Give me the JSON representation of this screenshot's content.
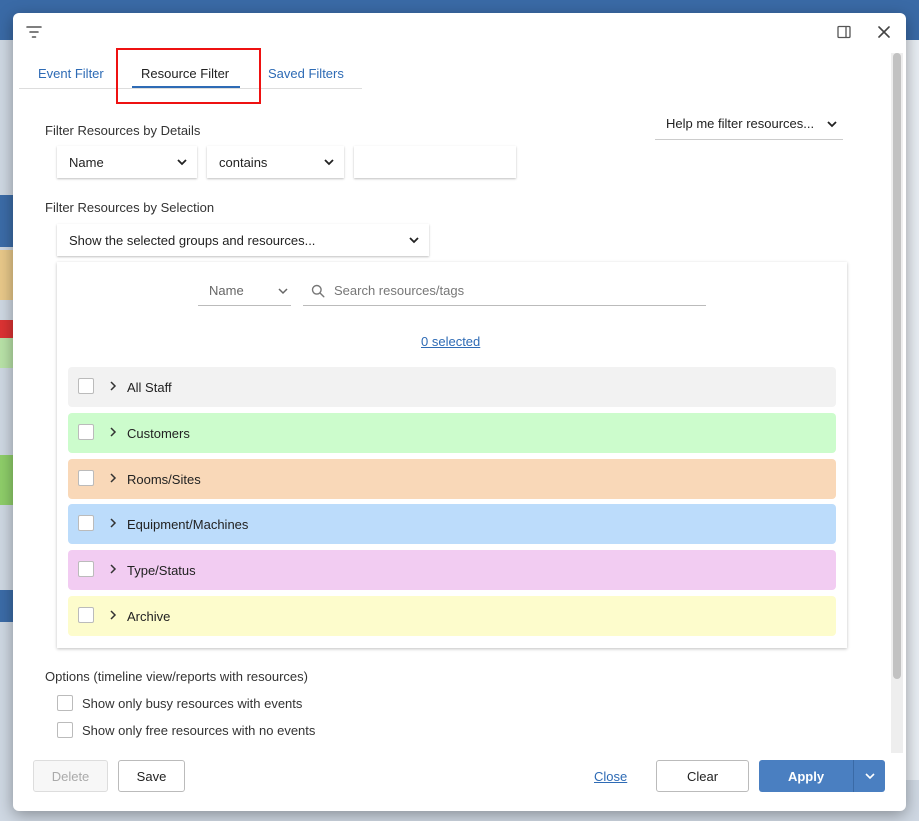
{
  "tabs": [
    {
      "label": "Event Filter"
    },
    {
      "label": "Resource Filter"
    },
    {
      "label": "Saved Filters"
    }
  ],
  "details": {
    "heading": "Filter Resources by Details",
    "field_select": "Name",
    "operator_select": "contains",
    "value": "",
    "help_dropdown": "Help me filter resources..."
  },
  "selection": {
    "heading": "Filter Resources by Selection",
    "mode_select": "Show the selected groups and resources...",
    "sort_select": "Name",
    "search_placeholder": "Search resources/tags",
    "selected_count": "0 selected",
    "groups": [
      {
        "name": "All Staff",
        "color": "#f2f2f2"
      },
      {
        "name": "Customers",
        "color": "#ccfccc"
      },
      {
        "name": "Rooms/Sites",
        "color": "#f9d8b8"
      },
      {
        "name": "Equipment/Machines",
        "color": "#bcdcfb"
      },
      {
        "name": "Type/Status",
        "color": "#f2ccf2"
      },
      {
        "name": "Archive",
        "color": "#fdfccc"
      }
    ]
  },
  "options": {
    "heading": "Options (timeline view/reports with resources)",
    "busy_only": "Show only busy resources with events",
    "free_only": "Show only free resources with no events"
  },
  "footer": {
    "delete": "Delete",
    "save": "Save",
    "close": "Close",
    "clear": "Clear",
    "apply": "Apply"
  },
  "colors": {
    "accent": "#4a7fc1",
    "link": "#2e6bb5",
    "highlight": "#e11111"
  }
}
